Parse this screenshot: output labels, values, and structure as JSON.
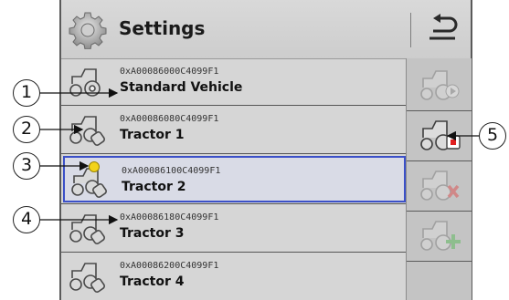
{
  "header": {
    "title": "Settings",
    "settings_icon": "gear-icon",
    "back_icon": "back-arrow-icon"
  },
  "vehicles": [
    {
      "id": "0xA00086000C4099F1",
      "name": "Standard Vehicle",
      "selected": false
    },
    {
      "id": "0xA00086080C4099F1",
      "name": "Tractor  1",
      "selected": false
    },
    {
      "id": "0xA00086100C4099F1",
      "name": "Tractor  2",
      "selected": true,
      "active": true
    },
    {
      "id": "0xA00086180C4099F1",
      "name": "Tractor  3",
      "selected": false
    },
    {
      "id": "0xA00086200C4099F1",
      "name": "Tractor  4",
      "selected": false
    }
  ],
  "sidebar": {
    "buttons": [
      {
        "icon": "tractor-activate-icon",
        "enabled": false
      },
      {
        "icon": "tractor-edit-icon",
        "enabled": true
      },
      {
        "icon": "tractor-delete-icon",
        "enabled": false
      },
      {
        "icon": "tractor-add-icon",
        "enabled": false
      }
    ]
  },
  "callouts": [
    "1",
    "2",
    "3",
    "4",
    "5"
  ],
  "colors": {
    "selection_border": "#3b50c8",
    "active_indicator": "#f2d31a",
    "delete_red": "#e04040",
    "add_green": "#4db84d",
    "edit_red": "#e02020"
  }
}
